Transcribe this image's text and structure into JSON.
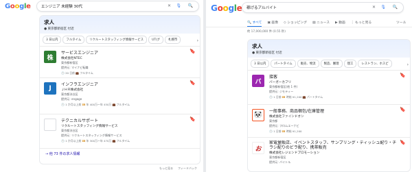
{
  "left": {
    "logo": "Google",
    "query": "エンジニア 未経験 30代",
    "jobs": {
      "title": "求人",
      "location": "● 東京都新宿区 付近",
      "chips": [
        "3 日以内",
        "フルタイム",
        "リクルートスタッフィング情報サービス",
        "UT(グ",
        "札幌市"
      ],
      "listings": [
        {
          "logo_text": "株",
          "logo_color": "#2e7d32",
          "title": "サービスエンジニア",
          "company": "株式会社NTEC",
          "location": "東京都新宿区",
          "source": "提供元: マイナビ転職",
          "meta": "🕓 20 日前  💼 フルタイム"
        },
        {
          "logo_text": "J",
          "logo_color": "#1e73be",
          "title": "インフラエンジニア",
          "company": "ＪＨＲ株式会社",
          "location": "東京都渋谷区",
          "source": "提供元: engage",
          "meta": "🕓 1 か月以上前  💴 年 400万～年 450万  💼 フルタイム"
        },
        {
          "logo_text": "",
          "logo_color": "#ffffff",
          "title": "テクニカルサポート",
          "company": "リクルートスタッフィング情報サービス",
          "location": "東京都渋谷区",
          "source": "提供元: リクルートスタッフィング情報サービス",
          "meta": "🕓 1 か月以上前  💴 年 300万～年 470万  💼 フルタイム"
        }
      ],
      "more_link": "→  他 73 件の求人情報"
    },
    "footer": [
      "もっと見る",
      "フィードバック"
    ]
  },
  "right": {
    "logo": "Google",
    "query": "稼げるアルバイト",
    "tabs": [
      "🔍 すべて",
      "▣ 画像",
      "◇ ショッピング",
      "▤ ニュース",
      "▶ 動画",
      "⋮ もっと見る"
    ],
    "tools": "ツール",
    "stats": "約 17,000,000 件  (0.55 秒)",
    "jobs": {
      "title": "求人",
      "location": "● 東京都新宿区 付近",
      "chips": [
        "3 日以内",
        "パートタイム",
        "販売、物流",
        "製造、審理",
        "理工",
        "レストラン、ホスピ"
      ],
      "listings": [
        {
          "logo_text": "バ",
          "logo_color": "#9c27b0",
          "title": "接客",
          "company": "バーガーカフリ",
          "location": "東京都新宿区(他 1 件)",
          "source": "提供元: ジモティー",
          "meta": "🕓 1 日前  💴 時給 ¥1,200  💼 パートタイム"
        },
        {
          "logo_text": "🐼",
          "logo_color": "#d84315",
          "title": "一般事務、商品梱包/在庫管理",
          "company": "株式会社ファインドオン",
          "location": "東京都",
          "source": "提供元: フロムエーナビ",
          "meta": "🕓 1 日前  💴 時給 ¥1,200"
        },
        {
          "logo_text": "お",
          "logo_color": "#c62828",
          "title": "家電量販店、イベントスタッフ、サンプリング・ティッシュ配り・チラシ配りのビラ配り、携帯販売",
          "company": "株式会社レジェンドプロモーション",
          "location": "東京都新宿区",
          "source": "提供元: バイトル",
          "meta": ""
        }
      ]
    }
  }
}
